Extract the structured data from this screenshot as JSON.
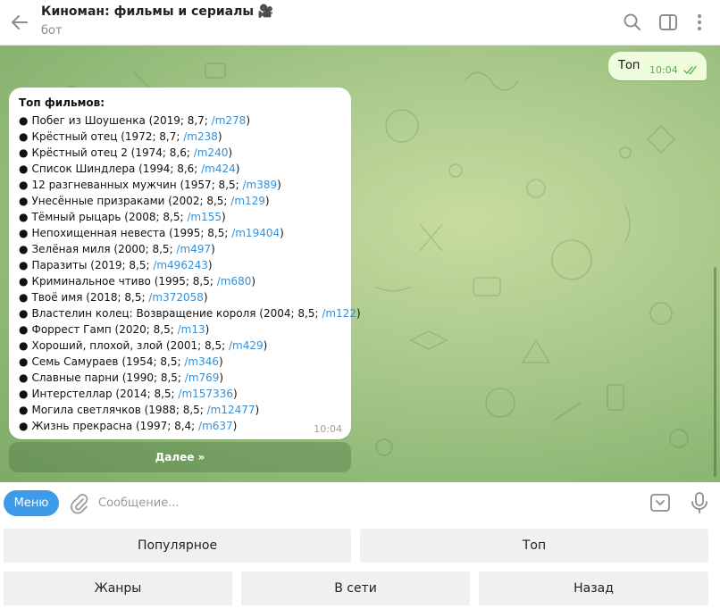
{
  "header": {
    "title": "Киноман: фильмы и сериалы 🎥",
    "subtitle": "бот"
  },
  "outgoing": {
    "text": "Топ",
    "time": "10:04"
  },
  "incoming": {
    "title": "Топ фильмов:",
    "bullet": "●",
    "items": [
      {
        "text": "Побег из Шоушенка (2019; 8,7; ",
        "link": "/m278",
        "close": ")"
      },
      {
        "text": "Крёстный отец (1972; 8,7; ",
        "link": "/m238",
        "close": ")"
      },
      {
        "text": "Крёстный отец 2 (1974; 8,6; ",
        "link": "/m240",
        "close": ")"
      },
      {
        "text": "Список Шиндлера (1994; 8,6; ",
        "link": "/m424",
        "close": ")"
      },
      {
        "text": "12 разгневанных мужчин (1957; 8,5; ",
        "link": "/m389",
        "close": ")"
      },
      {
        "text": "Унесённые призраками (2002; 8,5; ",
        "link": "/m129",
        "close": ")"
      },
      {
        "text": "Тёмный рыцарь (2008; 8,5; ",
        "link": "/m155",
        "close": ")"
      },
      {
        "text": "Непохищенная невеста (1995; 8,5; ",
        "link": "/m19404",
        "close": ")"
      },
      {
        "text": "Зелёная миля (2000; 8,5; ",
        "link": "/m497",
        "close": ")"
      },
      {
        "text": "Паразиты (2019; 8,5; ",
        "link": "/m496243",
        "close": ")"
      },
      {
        "text": "Криминальное чтиво (1995; 8,5; ",
        "link": "/m680",
        "close": ")"
      },
      {
        "text": "Твоё имя (2018; 8,5; ",
        "link": "/m372058",
        "close": ")"
      },
      {
        "text": "Властелин колец: Возвращение короля (2004; 8,5; ",
        "link": "/m122",
        "close": ")"
      },
      {
        "text": "Форрест Гамп (2020; 8,5; ",
        "link": "/m13",
        "close": ")"
      },
      {
        "text": "Хороший, плохой, злой (2001; 8,5; ",
        "link": "/m429",
        "close": ")"
      },
      {
        "text": "Семь Самураев (1954; 8,5; ",
        "link": "/m346",
        "close": ")"
      },
      {
        "text": "Славные парни (1990; 8,5; ",
        "link": "/m769",
        "close": ")"
      },
      {
        "text": "Интерстеллар (2014; 8,5; ",
        "link": "/m157336",
        "close": ")"
      },
      {
        "text": "Могила светлячков (1988; 8,5; ",
        "link": "/m12477",
        "close": ")"
      },
      {
        "text": "Жизнь прекрасна (1997; 8,4; ",
        "link": "/m637",
        "close": ")"
      }
    ],
    "time": "10:04",
    "inline_button": "Далее »"
  },
  "composer": {
    "menu_label": "Меню",
    "placeholder": "Сообщение..."
  },
  "keyboard": {
    "rows": [
      [
        "Популярное",
        "Топ"
      ],
      [
        "Жанры",
        "В сети",
        "Назад"
      ]
    ]
  },
  "colors": {
    "accent": "#3d9be9",
    "link": "#3a8fd2",
    "outgoing_bubble": "#effdde",
    "read_check": "#5fae53"
  },
  "icons": {
    "back": "arrow-left-icon",
    "search": "search-icon",
    "sidebar": "sidebar-toggle-icon",
    "more": "more-vertical-icon",
    "read": "double-check-icon",
    "attach": "paperclip-icon",
    "keyboard": "bot-keyboard-icon",
    "mic": "microphone-icon"
  }
}
